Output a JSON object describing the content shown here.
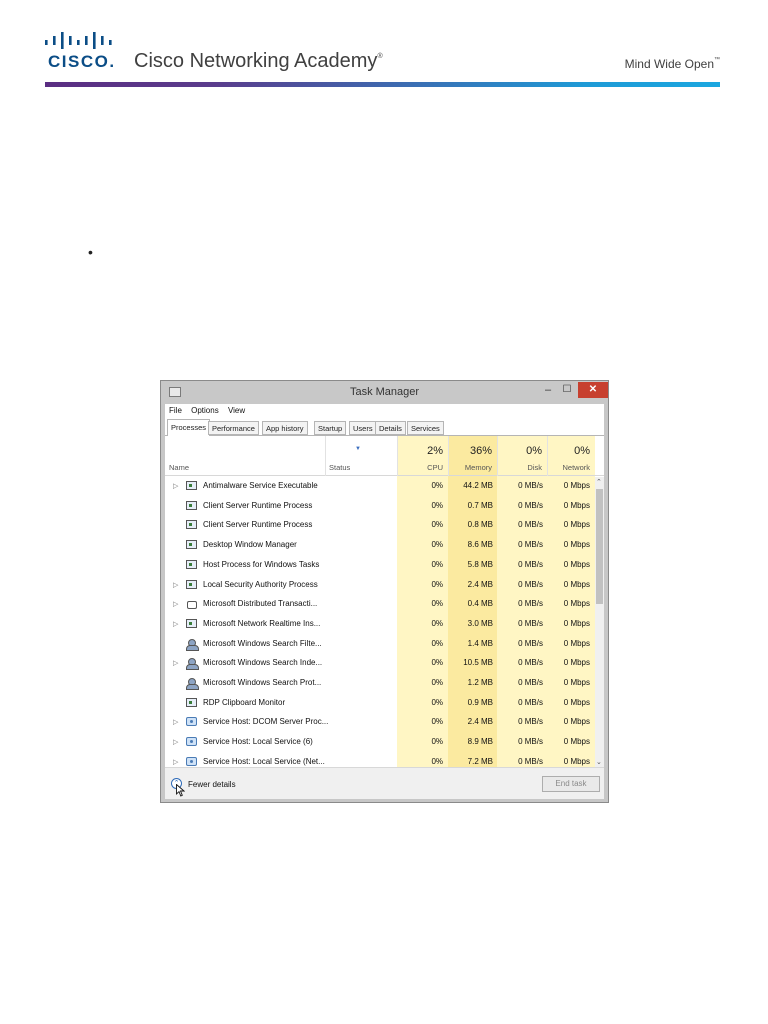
{
  "header": {
    "logo_word": "CISCO.",
    "academy_title": "Cisco Networking Academy",
    "academy_mark": "®",
    "tagline": "Mind Wide Open",
    "tagline_mark": "™",
    "accent_start": "#5a2d82",
    "accent_end": "#1ba7e0"
  },
  "bullet": "•",
  "task_manager": {
    "title": "Task Manager",
    "window_controls": {
      "minimize": "–",
      "maximize": "☐",
      "close": "✕"
    },
    "menu": [
      "File",
      "Options",
      "View"
    ],
    "tabs": [
      "Processes",
      "Performance",
      "App history",
      "Startup",
      "Users",
      "Details",
      "Services"
    ],
    "active_tab": "Processes",
    "columns": {
      "name": "Name",
      "status": "Status",
      "cpu": {
        "pct": "2%",
        "label": "CPU"
      },
      "memory": {
        "pct": "36%",
        "label": "Memory"
      },
      "disk": {
        "pct": "0%",
        "label": "Disk"
      },
      "network": {
        "pct": "0%",
        "label": "Network"
      }
    },
    "processes": [
      {
        "expand": "▷",
        "icon": "app-window-icon",
        "name": "Antimalware Service Executable",
        "cpu": "0%",
        "memory": "44.2 MB",
        "disk": "0 MB/s",
        "network": "0 Mbps"
      },
      {
        "expand": "",
        "icon": "app-window-icon",
        "name": "Client Server Runtime Process",
        "cpu": "0%",
        "memory": "0.7 MB",
        "disk": "0 MB/s",
        "network": "0 Mbps"
      },
      {
        "expand": "",
        "icon": "app-window-icon",
        "name": "Client Server Runtime Process",
        "cpu": "0%",
        "memory": "0.8 MB",
        "disk": "0 MB/s",
        "network": "0 Mbps"
      },
      {
        "expand": "",
        "icon": "app-window-icon",
        "name": "Desktop Window Manager",
        "cpu": "0%",
        "memory": "8.6 MB",
        "disk": "0 MB/s",
        "network": "0 Mbps"
      },
      {
        "expand": "",
        "icon": "app-window-icon",
        "name": "Host Process for Windows Tasks",
        "cpu": "0%",
        "memory": "5.8 MB",
        "disk": "0 MB/s",
        "network": "0 Mbps"
      },
      {
        "expand": "▷",
        "icon": "app-window-icon",
        "name": "Local Security Authority Process",
        "cpu": "0%",
        "memory": "2.4 MB",
        "disk": "0 MB/s",
        "network": "0 Mbps"
      },
      {
        "expand": "▷",
        "icon": "network-icon",
        "name": "Microsoft Distributed Transacti...",
        "cpu": "0%",
        "memory": "0.4 MB",
        "disk": "0 MB/s",
        "network": "0 Mbps"
      },
      {
        "expand": "▷",
        "icon": "app-window-icon",
        "name": "Microsoft Network Realtime Ins...",
        "cpu": "0%",
        "memory": "3.0 MB",
        "disk": "0 MB/s",
        "network": "0 Mbps"
      },
      {
        "expand": "",
        "icon": "user-icon",
        "name": "Microsoft Windows Search Filte...",
        "cpu": "0%",
        "memory": "1.4 MB",
        "disk": "0 MB/s",
        "network": "0 Mbps"
      },
      {
        "expand": "▷",
        "icon": "user-icon",
        "name": "Microsoft Windows Search Inde...",
        "cpu": "0%",
        "memory": "10.5 MB",
        "disk": "0 MB/s",
        "network": "0 Mbps"
      },
      {
        "expand": "",
        "icon": "user-icon",
        "name": "Microsoft Windows Search Prot...",
        "cpu": "0%",
        "memory": "1.2 MB",
        "disk": "0 MB/s",
        "network": "0 Mbps"
      },
      {
        "expand": "",
        "icon": "app-window-icon",
        "name": "RDP Clipboard Monitor",
        "cpu": "0%",
        "memory": "0.9 MB",
        "disk": "0 MB/s",
        "network": "0 Mbps"
      },
      {
        "expand": "▷",
        "icon": "gear-icon",
        "name": "Service Host: DCOM Server Proc...",
        "cpu": "0%",
        "memory": "2.4 MB",
        "disk": "0 MB/s",
        "network": "0 Mbps"
      },
      {
        "expand": "▷",
        "icon": "gear-icon",
        "name": "Service Host: Local Service (6)",
        "cpu": "0%",
        "memory": "8.9 MB",
        "disk": "0 MB/s",
        "network": "0 Mbps"
      },
      {
        "expand": "▷",
        "icon": "gear-icon",
        "name": "Service Host: Local Service (Net...",
        "cpu": "0%",
        "memory": "7.2 MB",
        "disk": "0 MB/s",
        "network": "0 Mbps"
      }
    ],
    "scroll": {
      "up": "⌃",
      "down": "⌄"
    },
    "fewer_details": "Fewer details",
    "fewer_icon_glyph": "⌃",
    "end_task": "End task"
  }
}
